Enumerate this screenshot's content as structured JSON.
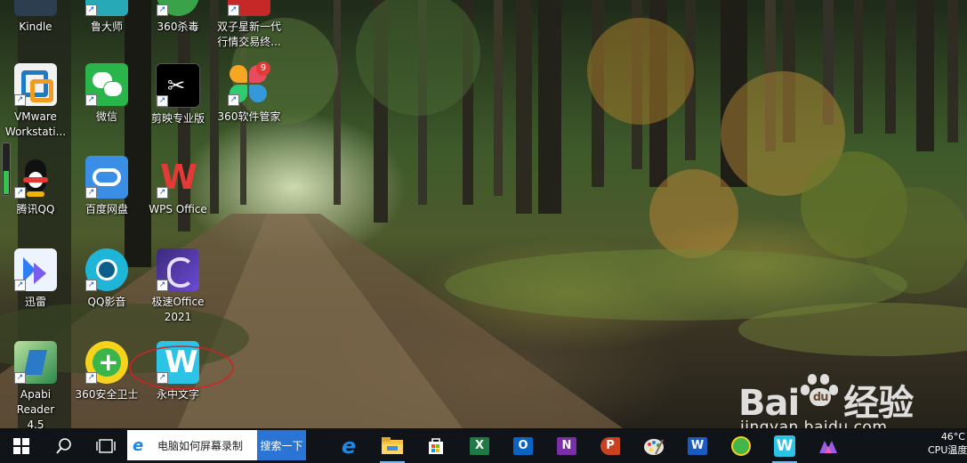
{
  "desktop": {
    "icons": [
      {
        "label": "Kindle"
      },
      {
        "label": "鲁大师"
      },
      {
        "label": "360杀毒"
      },
      {
        "label": "双子星新一代行情交易终..."
      },
      {
        "label": "VMware Workstati..."
      },
      {
        "label": "微信"
      },
      {
        "label": "剪映专业版"
      },
      {
        "label": "360软件管家",
        "badge": "9"
      },
      {
        "label": "腾讯QQ"
      },
      {
        "label": "百度网盘"
      },
      {
        "label": "WPS Office"
      },
      {
        "label": "迅雷"
      },
      {
        "label": "QQ影音"
      },
      {
        "label": "极速Office 2021"
      },
      {
        "label": "Apabi Reader 4.5"
      },
      {
        "label": "360安全卫士"
      },
      {
        "label": "永中文字"
      }
    ]
  },
  "taskbar": {
    "search_text": "电脑如何屏幕录制",
    "search_button": "搜索一下",
    "apps": [
      "edge-icon",
      "file-explorer-icon",
      "store-icon",
      "excel-icon",
      "outlook-icon",
      "onenote-icon",
      "powerpoint-icon",
      "paint-icon",
      "word-icon",
      "360-browser-icon",
      "yozo-writer-icon",
      "app-icon"
    ],
    "tray": {
      "temp": "46°C",
      "label": "CPU温度"
    }
  },
  "watermark": {
    "brand": "Bai",
    "paw": "du",
    "suffix": "经验",
    "url": "jingyan.baidu.com"
  },
  "colors": {
    "taskbar": "#101418",
    "search_button": "#2a74d6",
    "highlight_circle": "#d22222"
  }
}
